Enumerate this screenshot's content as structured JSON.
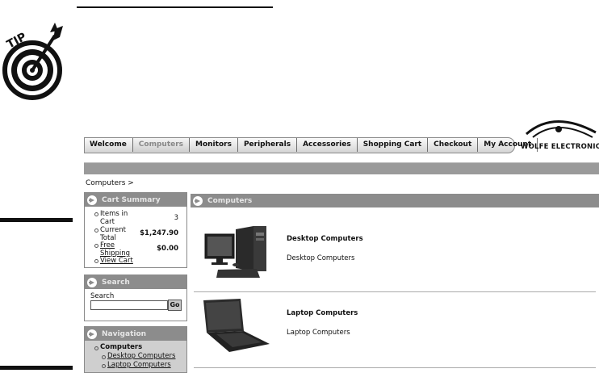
{
  "tip": {
    "label": "TIP"
  },
  "nav": {
    "tabs": [
      "Welcome",
      "Computers",
      "Monitors",
      "Peripherals",
      "Accessories",
      "Shopping Cart",
      "Checkout",
      "My Account"
    ],
    "active": "Computers"
  },
  "logo": {
    "text": "WOLFE ELECTRONICS"
  },
  "breadcrumb": "Computers >",
  "cart": {
    "title": "Cart Summary",
    "items_label": "Items in Cart",
    "items_value": "3",
    "total_label": "Current Total",
    "total_value": "$1,247.90",
    "shipping_label": "Free Shipping",
    "shipping_value": "$0.00",
    "view_cart": "View Cart"
  },
  "search": {
    "title": "Search",
    "label": "Search",
    "button": "Go"
  },
  "navigation": {
    "title": "Navigation",
    "root": "Computers",
    "items": [
      "Desktop Computers",
      "Laptop Computers"
    ]
  },
  "main": {
    "title": "Computers",
    "products": [
      {
        "title": "Desktop Computers",
        "desc": "Desktop Computers"
      },
      {
        "title": "Laptop Computers",
        "desc": "Laptop Computers"
      }
    ]
  }
}
